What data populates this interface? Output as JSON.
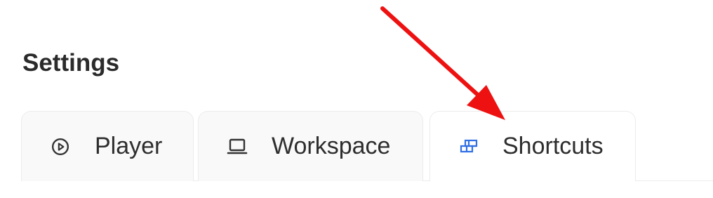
{
  "page": {
    "title": "Settings"
  },
  "tabs": [
    {
      "label": "Player",
      "icon": "play-circle-icon",
      "active": false
    },
    {
      "label": "Workspace",
      "icon": "laptop-icon",
      "active": false
    },
    {
      "label": "Shortcuts",
      "icon": "grid-shortcut-icon",
      "active": true
    }
  ],
  "colors": {
    "title": "#2b2b2b",
    "tab_text": "#2e2e2e",
    "tab_inactive_bg": "#f9f9f9",
    "tab_active_bg": "#ffffff",
    "tab_border": "#ececec",
    "icon_default": "#333333",
    "icon_active": "#2f6fe4",
    "annotation_arrow": "#ee1111"
  },
  "annotation": {
    "type": "arrow",
    "points_to": "Shortcuts"
  }
}
